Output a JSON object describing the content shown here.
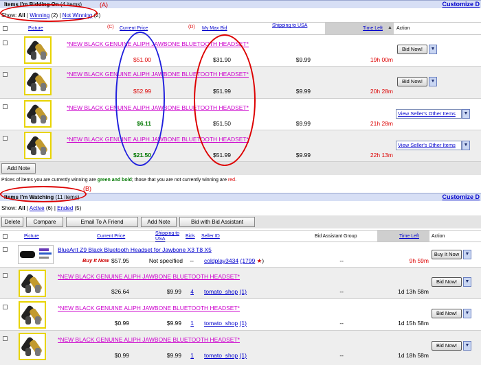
{
  "annotations": {
    "A": "(A)",
    "B": "(B)",
    "C": "(C)",
    "D": "(D)"
  },
  "bidding": {
    "title": "Items I'm Bidding On",
    "count": "(4 items)",
    "customize": "Customize D",
    "show_label": "Show:",
    "show_all": "All",
    "show_winning": "Winning",
    "show_winning_count": "(2)",
    "show_notwinning": "Not Winning",
    "show_notwinning_count": "(2)",
    "columns": {
      "picture": "Picture",
      "price": "Current Price",
      "maxbid": "My Max Bid",
      "shipping": "Shipping to USA",
      "timeleft": "Time Left",
      "action": "Action"
    },
    "rows": [
      {
        "title": "*NEW BLACK GENUINE ALIPH JAWBONE BLUETOOTH HEADSET*",
        "price": "$51.00",
        "maxbid": "$31.90",
        "shipping": "$9.99",
        "timeleft": "19h 00m",
        "action": "Bid Now!"
      },
      {
        "title": "*NEW BLACK GENUINE ALIPH JAWBONE BLUETOOTH HEADSET*",
        "price": "$52.99",
        "maxbid": "$51.99",
        "shipping": "$9.99",
        "timeleft": "20h 28m",
        "action": "Bid Now!"
      },
      {
        "title": "*NEW BLACK GENUINE ALIPH JAWBONE BLUETOOTH HEADSET*",
        "price": "$6.11",
        "maxbid": "$51.50",
        "shipping": "$9.99",
        "timeleft": "21h 28m",
        "action": "View Seller's Other Items"
      },
      {
        "title": "*NEW BLACK GENUINE ALIPH JAWBONE BLUETOOTH HEADSET*",
        "price": "$21.50",
        "maxbid": "$51.99",
        "shipping": "$9.99",
        "timeleft": "22h 13m",
        "action": "View Seller's Other Items"
      }
    ],
    "add_note": "Add Note",
    "legend_a": "Prices of items you are currently winning are",
    "legend_b": "green and bold",
    "legend_c": "; those that you are not currently winning are",
    "legend_d": "red",
    "legend_e": "."
  },
  "watching": {
    "title": "Items I'm Watching",
    "count": "(11 items)",
    "customize": "Customize D",
    "show_label": "Show:",
    "show_all": "All",
    "show_active": "Active",
    "show_active_count": "(6)",
    "show_ended": "Ended",
    "show_ended_count": "(5)",
    "toolbar": {
      "delete": "Delete",
      "compare": "Compare",
      "email": "Email To A Friend",
      "addnote": "Add Note",
      "bidassist": "Bid with Bid Assistant"
    },
    "columns": {
      "picture": "Picture",
      "price": "Current Price",
      "shipping": "Shipping to USA",
      "bids": "Bids",
      "seller": "Seller ID",
      "group": "Bid Assistant Group",
      "timeleft": "Time Left",
      "action": "Action"
    },
    "rows": [
      {
        "title": "BlueAnt Z9 Black Bluetooth Headset for Jawbone X3 T8 X5",
        "buyitnow": "Buy It Now",
        "price": "$57.95",
        "shipping": "Not specified",
        "bids": "--",
        "seller": "coldplay3434",
        "feedback": "(1799",
        "feedback_end": ")",
        "group": "--",
        "timeleft": "9h 59m",
        "action": "Buy It Now"
      },
      {
        "title": "*NEW BLACK GENUINE ALIPH JAWBONE BLUETOOTH HEADSET*",
        "price": "$26.64",
        "shipping": "$9.99",
        "bids": "4",
        "seller": "tomato_shop",
        "feedback": "(1)",
        "group": "--",
        "timeleft": "1d 13h 58m",
        "action": "Bid Now!"
      },
      {
        "title": "*NEW BLACK GENUINE ALIPH JAWBONE BLUETOOTH HEADSET*",
        "price": "$0.99",
        "shipping": "$9.99",
        "bids": "1",
        "seller": "tomato_shop",
        "feedback": "(1)",
        "group": "--",
        "timeleft": "1d 15h 58m",
        "action": "Bid Now!"
      },
      {
        "title": "*NEW BLACK GENUINE ALIPH JAWBONE BLUETOOTH HEADSET*",
        "price": "$0.99",
        "shipping": "$9.99",
        "bids": "1",
        "seller": "tomato_shop",
        "feedback": "(1)",
        "group": "--",
        "timeleft": "1d 18h 58m",
        "action": "Bid Now!"
      }
    ]
  }
}
